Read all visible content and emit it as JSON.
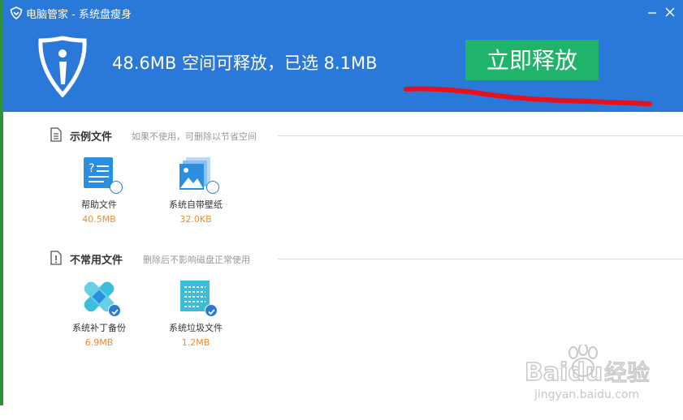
{
  "window": {
    "title": "电脑管家 - 系统盘瘦身",
    "minimize_icon": "minimize-icon",
    "close_icon": "close-icon"
  },
  "banner": {
    "headline": "48.6MB 空间可释放，已选 8.1MB",
    "release_button": "立即释放",
    "logo_icon": "shield-logo-icon",
    "brand_color": "#2a79d8",
    "button_color": "#20b36a",
    "annotation_color": "#e8101a"
  },
  "sections": [
    {
      "title": "示例文件",
      "description": "如果不使用，可删除以节省空间",
      "icon": "document-icon",
      "items": [
        {
          "label": "帮助文件",
          "size": "40.5MB",
          "icon": "help-document-icon",
          "checked": false
        },
        {
          "label": "系统自带壁纸",
          "size": "32.0KB",
          "icon": "wallpaper-icon",
          "checked": false
        }
      ]
    },
    {
      "title": "不常用文件",
      "description": "删除后不影响磁盘正常使用",
      "icon": "warning-document-icon",
      "items": [
        {
          "label": "系统补丁备份",
          "size": "6.9MB",
          "icon": "patch-bandage-icon",
          "checked": true
        },
        {
          "label": "系统垃圾文件",
          "size": "1.2MB",
          "icon": "junk-file-icon",
          "checked": true
        }
      ]
    }
  ],
  "watermark": {
    "brand": "Baidu",
    "product": "经验",
    "url": "jingyan.baidu.com"
  },
  "size_color": "#f08a2a"
}
